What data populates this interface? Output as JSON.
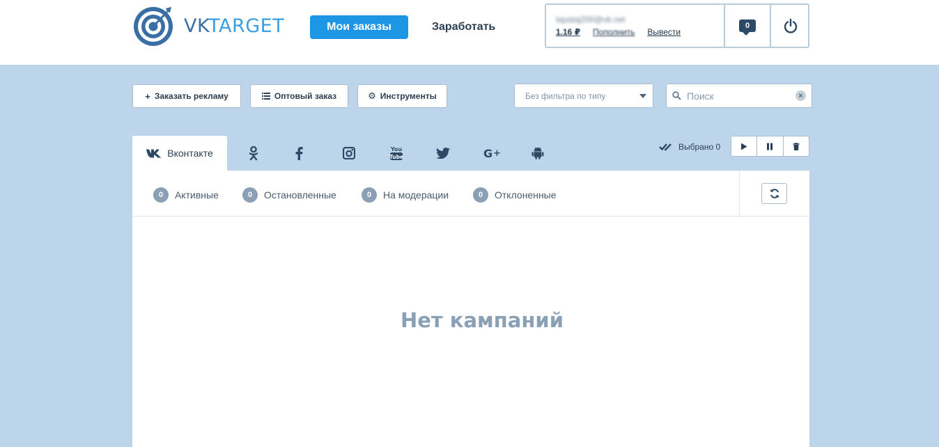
{
  "brand": {
    "part1": "VK",
    "part2": "TARGET",
    "color_primary": "#3a6fa5",
    "color_accent": "#3a9ee0"
  },
  "nav": {
    "orders_label": "Мои заказы",
    "earn_label": "Заработать"
  },
  "account": {
    "email": "lapataj200@vk.net",
    "balance": "1.16 ₽",
    "topup_label": "Пополнить",
    "withdraw_label": "Вывести",
    "messages_count": "0"
  },
  "toolbar": {
    "order_ad_label": "Заказать рекламу",
    "bulk_order_label": "Оптовый заказ",
    "tools_label": "Инструменты",
    "filter_selected": "Без фильтра по типу",
    "search_placeholder": "Поиск"
  },
  "tabs": {
    "active_label": "Вконтакте",
    "icons": [
      "odnoklassniki-icon",
      "facebook-icon",
      "instagram-icon",
      "youtube-icon",
      "twitter-icon",
      "google-plus-icon",
      "android-icon"
    ]
  },
  "selection": {
    "label": "Выбрано 0"
  },
  "statuses": [
    {
      "count": "0",
      "label": "Активные"
    },
    {
      "count": "0",
      "label": "Остановленные"
    },
    {
      "count": "0",
      "label": "На модерации"
    },
    {
      "count": "0",
      "label": "Отклоненные"
    }
  ],
  "empty_message": "Нет кампаний",
  "colors": {
    "page_bg": "#bdd5ea",
    "nav_active": "#1e96e6",
    "badge": "#8ba0b4"
  }
}
